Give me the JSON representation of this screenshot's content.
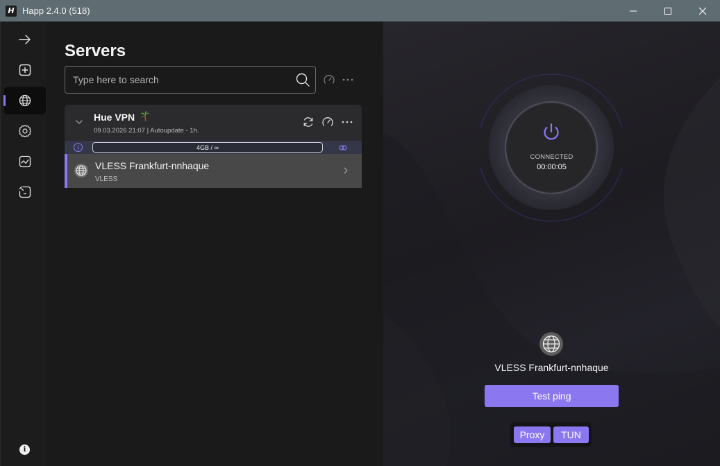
{
  "window": {
    "logo_letter": "H",
    "title": "Happ 2.4.0 (518)"
  },
  "sidebar": {
    "items": [
      {
        "name": "connect",
        "icon": "arrow-right-icon"
      },
      {
        "name": "add",
        "icon": "plus-square-icon"
      },
      {
        "name": "servers",
        "icon": "globe-icon",
        "active": true
      },
      {
        "name": "settings",
        "icon": "gear-icon"
      },
      {
        "name": "stats",
        "icon": "chart-icon"
      },
      {
        "name": "routing",
        "icon": "routing-icon"
      }
    ],
    "info_label": "i"
  },
  "servers_panel": {
    "title": "Servers",
    "search": {
      "placeholder": "Type here to search",
      "value": ""
    },
    "group": {
      "name": "Hue VPN",
      "emoji_icon": "palm-tree-icon",
      "meta": "09.03.2026 21:07 | Autoupdate - 1h.",
      "usage": "4GB / ∞",
      "servers": [
        {
          "name": "VLESS Frankfurt-nnhaque",
          "protocol": "VLESS",
          "selected": true
        }
      ]
    }
  },
  "status_panel": {
    "status": "CONNECTED",
    "elapsed": "00:00:05",
    "server_name": "VLESS Frankfurt-nnhaque",
    "test_ping_label": "Test ping",
    "modes": {
      "proxy": "Proxy",
      "tun": "TUN"
    }
  },
  "colors": {
    "accent": "#8b78f0",
    "titlebar": "#5f6c72",
    "panel_bg": "#1a1a1a"
  }
}
